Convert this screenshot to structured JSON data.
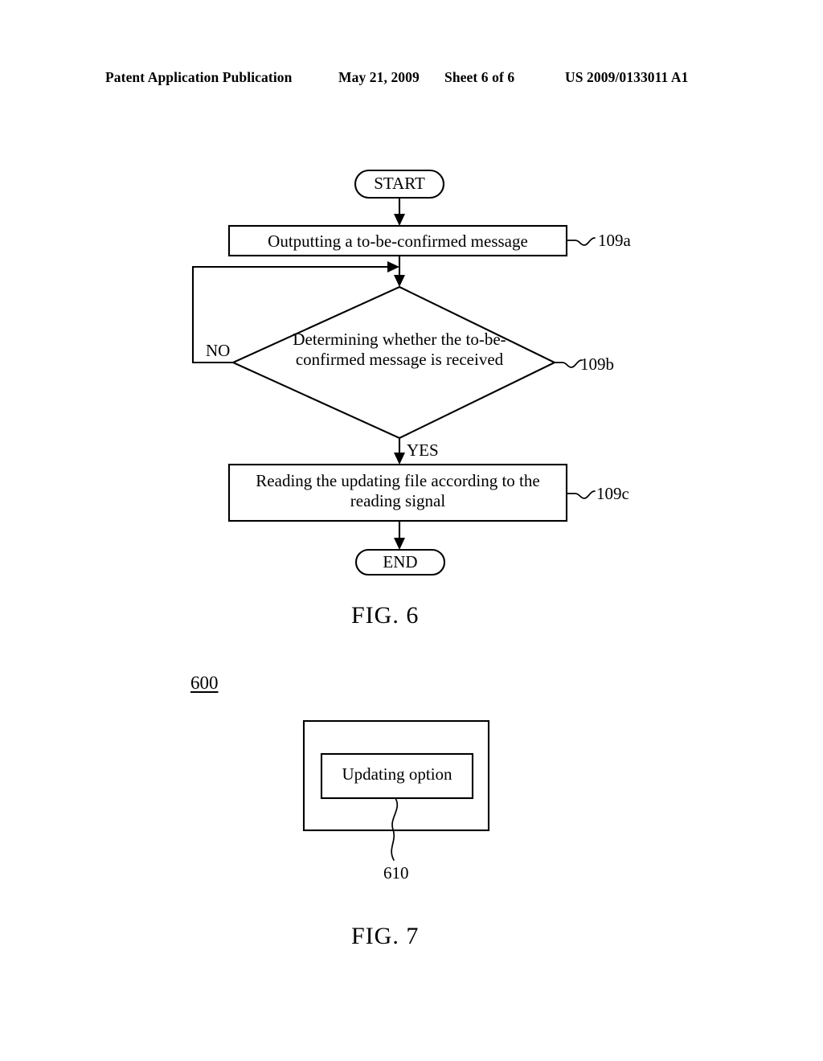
{
  "header": {
    "publication": "Patent Application Publication",
    "date": "May 21, 2009",
    "sheet": "Sheet 6 of 6",
    "patent_number": "US 2009/0133011 A1"
  },
  "figures": [
    {
      "caption": "FIG.  6",
      "type": "flowchart",
      "nodes": [
        {
          "id": "start",
          "shape": "terminator",
          "label": "START"
        },
        {
          "id": "109a",
          "shape": "process",
          "label": "Outputting a to-be-confirmed message",
          "reference": "109a"
        },
        {
          "id": "109b",
          "shape": "decision",
          "label": "Determining whether the to-be-confirmed message is received",
          "reference": "109b"
        },
        {
          "id": "109c",
          "shape": "process",
          "label": "Reading the updating file according to the reading signal",
          "reference": "109c"
        },
        {
          "id": "end",
          "shape": "terminator",
          "label": "END"
        }
      ],
      "branch_labels": {
        "no": "NO",
        "yes": "YES"
      }
    },
    {
      "caption": "FIG.  7",
      "type": "block-diagram",
      "outer_reference": "600",
      "inner_label": "Updating option",
      "inner_reference": "610"
    }
  ],
  "colors": {
    "ink": "#000000",
    "paper": "#ffffff"
  }
}
